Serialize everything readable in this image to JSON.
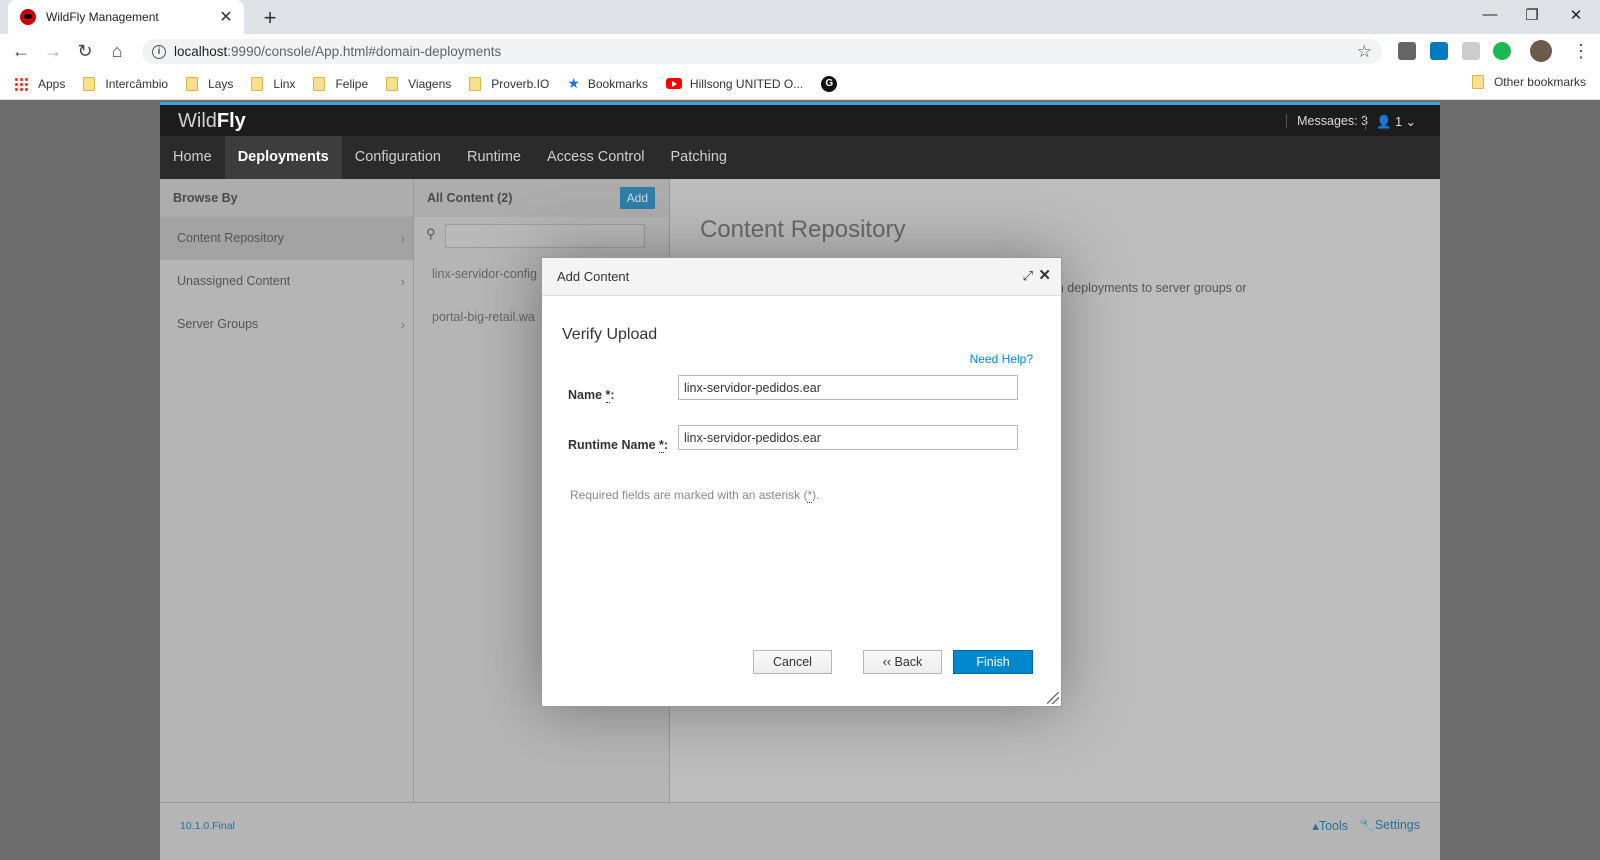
{
  "browser": {
    "tab_title": "WildFly Management",
    "url_host": "localhost",
    "url_rest": ":9990/console/App.html#domain-deployments",
    "bookmarks": [
      "Apps",
      "Intercâmbio",
      "Lays",
      "Linx",
      "Felipe",
      "Viagens",
      "Proverb.IO",
      "Bookmarks",
      "Hillsong UNITED O...",
      "G"
    ],
    "other_bookmarks": "Other bookmarks"
  },
  "app": {
    "brand_light": "Wild",
    "brand_bold": "Fly",
    "messages": "Messages: 3",
    "user": "1",
    "nav": [
      "Home",
      "Deployments",
      "Configuration",
      "Runtime",
      "Access Control",
      "Patching"
    ],
    "active_nav": "Deployments"
  },
  "browse": {
    "header": "Browse By",
    "items": [
      "Content Repository",
      "Unassigned Content",
      "Server Groups"
    ]
  },
  "content": {
    "header": "All Content (2)",
    "add_label": "Add",
    "items": [
      "linx-servidor-config",
      "portal-big-retail.wa"
    ]
  },
  "repository": {
    "title": "Content Repository",
    "fragment1": "n.",
    "fragment2": ". Assign deployments to server groups or"
  },
  "footer": {
    "version": "10.1.0.Final",
    "tools": "Tools",
    "settings": "Settings"
  },
  "modal": {
    "title": "Add Content",
    "step_title": "Verify Upload",
    "need_help": "Need Help?",
    "name_label": "Name",
    "name_value": "linx-servidor-pedidos.ear",
    "runtime_name_label": "Runtime Name",
    "runtime_name_value": "linx-servidor-pedidos.ear",
    "required_prefix": "Required fields are marked with an asterisk (",
    "required_star": "*",
    "required_suffix": ").",
    "cancel": "Cancel",
    "back": "‹‹ Back",
    "finish": "Finish"
  }
}
